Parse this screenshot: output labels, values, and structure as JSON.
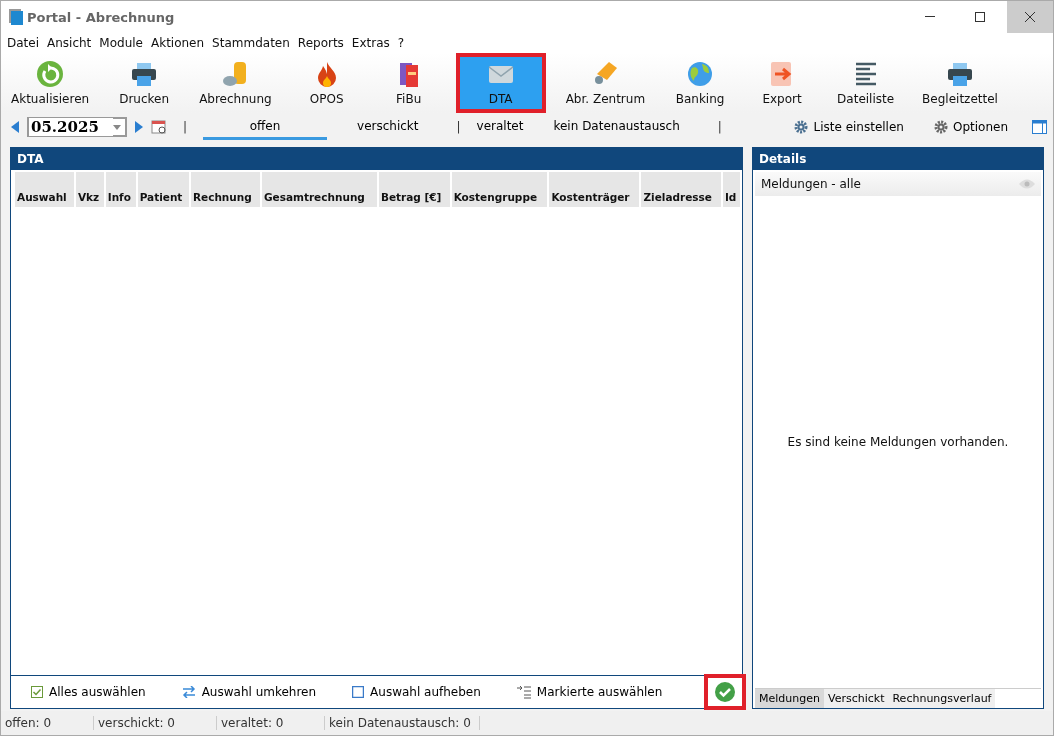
{
  "window": {
    "title": "Portal - Abrechnung"
  },
  "menu": [
    "Datei",
    "Ansicht",
    "Module",
    "Aktionen",
    "Stammdaten",
    "Reports",
    "Extras",
    "?"
  ],
  "toolbar": [
    {
      "label": "Aktualisieren",
      "kind": "refresh",
      "selected": false
    },
    {
      "label": "Drucken",
      "kind": "printer",
      "selected": false
    },
    {
      "label": "Abrechnung",
      "kind": "coins",
      "selected": false
    },
    {
      "label": "OPOS",
      "kind": "flame",
      "selected": false
    },
    {
      "label": "FiBu",
      "kind": "books",
      "selected": false
    },
    {
      "label": "DTA",
      "kind": "mail",
      "selected": true
    },
    {
      "label": "Abr. Zentrum",
      "kind": "hand",
      "selected": false
    },
    {
      "label": "Banking",
      "kind": "globe",
      "selected": false
    },
    {
      "label": "Export",
      "kind": "export",
      "selected": false
    },
    {
      "label": "Dateiliste",
      "kind": "lines",
      "selected": false
    },
    {
      "label": "Begleitzettel",
      "kind": "printer",
      "selected": false
    }
  ],
  "period": {
    "value": "05.2025"
  },
  "filters": [
    {
      "kind": "separator",
      "label": "|"
    },
    {
      "kind": "tab",
      "label": "offen",
      "selected": true
    },
    {
      "kind": "tab",
      "label": "verschickt",
      "selected": false
    },
    {
      "kind": "separator",
      "label": "|"
    },
    {
      "kind": "tab",
      "label": "veraltet",
      "selected": false
    },
    {
      "kind": "tab",
      "label": "kein Datenaustausch",
      "selected": false
    },
    {
      "kind": "separator",
      "label": "|"
    }
  ],
  "right_actions": [
    {
      "label": "Liste einstellen"
    },
    {
      "label": "Optionen"
    }
  ],
  "list_panel": {
    "title": "DTA",
    "columns": [
      "Auswahl",
      "Vkz",
      "Info",
      "Patient",
      "Rechnung",
      "Gesamtrechnung",
      "Betrag [€]",
      "Kostengruppe",
      "Kostenträger",
      "Zieladresse",
      "Id"
    ],
    "actions": [
      {
        "label": "Alles auswählen",
        "kind": "check-all"
      },
      {
        "label": "Auswahl umkehren",
        "kind": "swap"
      },
      {
        "label": "Auswahl aufheben",
        "kind": "uncheck"
      },
      {
        "label": "Markierte auswählen",
        "kind": "select-marked"
      }
    ],
    "confirm": {
      "highlighted": true
    }
  },
  "details": {
    "title": "Details",
    "filter": "Meldungen - alle",
    "empty_message": "Es sind keine Meldungen vorhanden.",
    "tabs": [
      {
        "label": "Meldungen",
        "selected": true
      },
      {
        "label": "Verschickt",
        "selected": false
      },
      {
        "label": "Rechnungsverlauf",
        "selected": false
      }
    ]
  },
  "status_bar": [
    "offen: 0",
    "verschickt: 0",
    "veraltet: 0",
    "kein Datenaustausch: 0"
  ]
}
